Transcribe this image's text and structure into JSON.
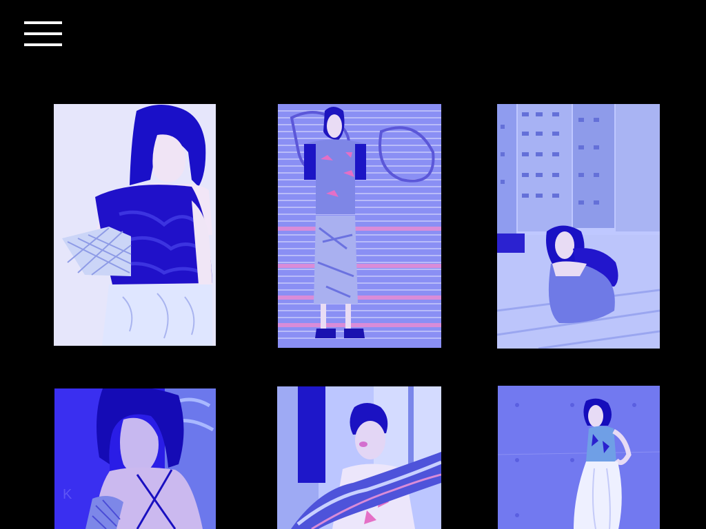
{
  "nav": {
    "menu_icon": "hamburger-menu-icon"
  },
  "gallery": {
    "columns": 3,
    "tiles": [
      {
        "id": "tile-1",
        "subject": "model-sculpted-top"
      },
      {
        "id": "tile-2",
        "subject": "model-shutter-backdrop"
      },
      {
        "id": "tile-3",
        "subject": "model-rooftop-towers"
      },
      {
        "id": "tile-4",
        "subject": "model-graffiti-wall"
      },
      {
        "id": "tile-5",
        "subject": "model-iridescent-drape"
      },
      {
        "id": "tile-6",
        "subject": "model-concrete-wall"
      }
    ]
  },
  "colors": {
    "background": "#000000",
    "menu_icon": "#ffffff",
    "duotone_dark": "#1d0fd8",
    "duotone_mid": "#5a66f0",
    "duotone_light": "#c8d0ff",
    "accent_pink": "#e46fc6"
  }
}
